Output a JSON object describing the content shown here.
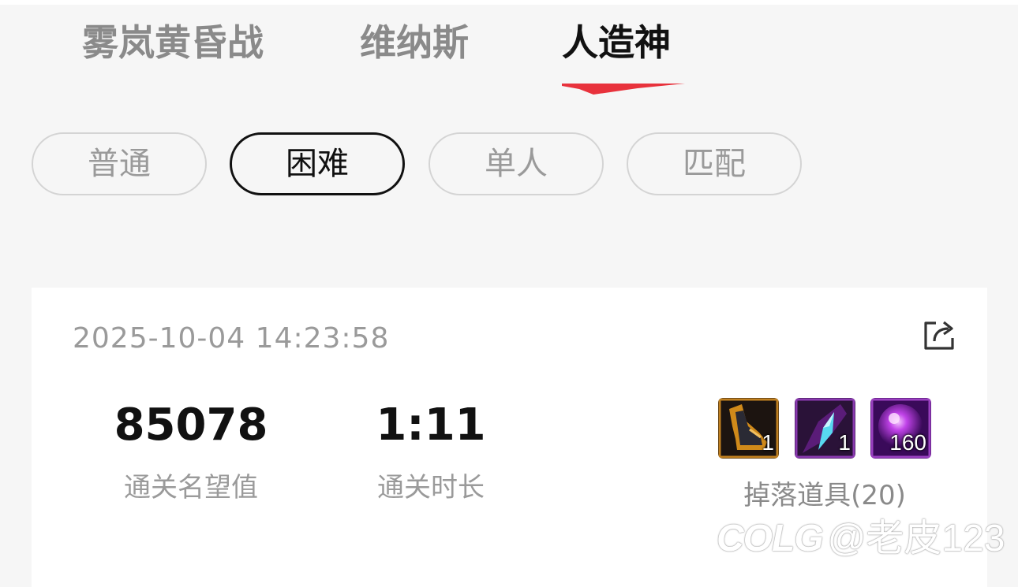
{
  "raid_tabs": [
    {
      "label": "雾岚黄昏战",
      "active": false
    },
    {
      "label": "维纳斯",
      "active": false
    },
    {
      "label": "人造神",
      "active": true
    }
  ],
  "difficulty_tabs": [
    {
      "label": "普通",
      "active": false
    },
    {
      "label": "困难",
      "active": true
    },
    {
      "label": "单人",
      "active": false
    },
    {
      "label": "匹配",
      "active": false
    }
  ],
  "record": {
    "timestamp": "2025-10-04 14:23:58",
    "share_icon": "share-icon",
    "fame": {
      "value": "85078",
      "label": "通关名望值"
    },
    "duration": {
      "value": "1:11",
      "label": "通关时长"
    },
    "drops": {
      "label": "掉落道具(20)",
      "items": [
        {
          "icon": "boots-item-icon",
          "count": "1"
        },
        {
          "icon": "crystal-shard-item-icon",
          "count": "1"
        },
        {
          "icon": "purple-orb-item-icon",
          "count": "160"
        }
      ]
    }
  },
  "watermark": {
    "logo": "COLG",
    "text": "@老皮123"
  },
  "colors": {
    "accent_red": "#e8323c",
    "active_text": "#111111",
    "inactive_text": "#8a8a8a",
    "background": "#f6f6f6",
    "card": "#ffffff"
  }
}
